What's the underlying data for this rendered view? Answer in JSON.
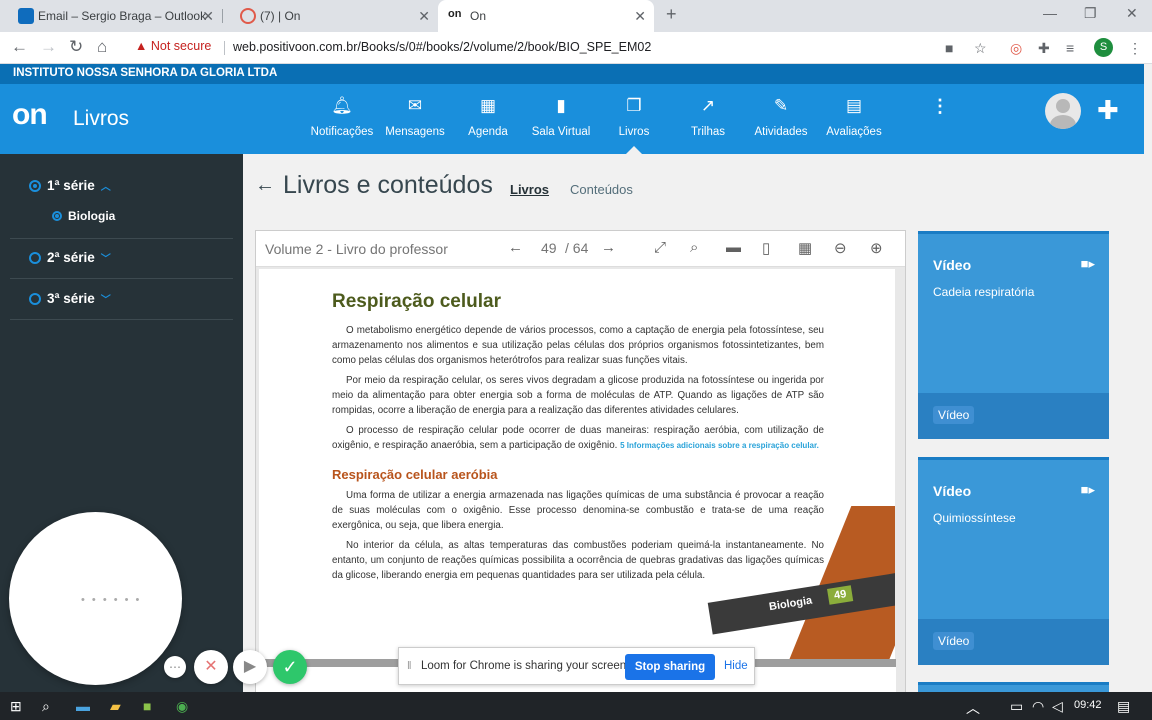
{
  "browser": {
    "tabs": [
      {
        "title": "Email – Sergio Braga – Outlook",
        "favicon": "outlook-icon"
      },
      {
        "title": "(7) | On",
        "favicon": "on-icon"
      },
      {
        "title": "On",
        "favicon": "on-icon"
      }
    ],
    "security": "Not secure",
    "url": "web.positivoon.com.br/Books/s/0#/books/2/volume/2/book/BIO_SPE_EM02",
    "profile_initial": "S"
  },
  "site": {
    "institution": "INSTITUTO NOSSA SENHORA DA GLORIA LTDA",
    "logo": "on",
    "brand": "Livros",
    "menu": [
      {
        "label": "Notificações",
        "icon": "bell-icon"
      },
      {
        "label": "Mensagens",
        "icon": "mail-icon"
      },
      {
        "label": "Agenda",
        "icon": "calendar-icon"
      },
      {
        "label": "Sala Virtual",
        "icon": "door-icon"
      },
      {
        "label": "Livros",
        "icon": "books-icon"
      },
      {
        "label": "Trilhas",
        "icon": "trend-icon"
      },
      {
        "label": "Atividades",
        "icon": "edit-icon"
      },
      {
        "label": "Avaliações",
        "icon": "clipboard-icon"
      }
    ]
  },
  "sidebar": {
    "series": [
      {
        "label": "1ª série",
        "selected": true
      },
      {
        "label": "2ª série",
        "selected": false
      },
      {
        "label": "3ª série",
        "selected": false
      }
    ],
    "subitem": "Biologia"
  },
  "main": {
    "title": "Livros e conteúdos",
    "tabs": [
      "Livros",
      "Conteúdos"
    ]
  },
  "viewer": {
    "volume": "Volume 2 - Livro do professor",
    "page": "49",
    "total": "/ 64",
    "doc": {
      "h1": "Respiração celular",
      "p1": "O metabolismo energético depende de vários processos, como a captação de energia pela fotossíntese, seu armazenamento nos alimentos e sua utilização pelas células dos próprios organismos fotossintetizantes, bem como pelas células dos organismos heterótrofos para realizar suas funções vitais.",
      "p2": "Por meio da respiração celular, os seres vivos degradam a glicose produzida na fotossíntese ou ingerida por meio da alimentação para obter energia sob a forma de moléculas de ATP. Quando as ligações de ATP são rompidas, ocorre a liberação de energia para a realização das diferentes atividades celulares.",
      "p3": "O processo de respiração celular pode ocorrer de duas maneiras: respiração aeróbia, com utilização de oxigênio, e respiração anaeróbia, sem a participação de oxigênio.",
      "p3_link": "5 Informações adicionais sobre a respiração celular.",
      "h2": "Respiração celular aeróbia",
      "p4": "Uma forma de utilizar a energia armazenada nas ligações químicas de uma substância é provocar a reação de suas moléculas com o oxigênio. Esse processo denomina-se combustão e trata-se de uma reação exergônica, ou seja, que libera energia.",
      "p5": "No interior da célula, as altas temperaturas das combustões poderiam queimá-la instantaneamente. No entanto, um conjunto de reações químicas possibilita a ocorrência de quebras gradativas das ligações químicas da glicose, liberando energia em pequenas quantidades para ser utilizada pela célula.",
      "ribbon_label": "Biologia",
      "ribbon_num": "49"
    }
  },
  "cards": [
    {
      "title": "Vídeo",
      "desc": "Cadeia respiratória",
      "tag": "Vídeo"
    },
    {
      "title": "Vídeo",
      "desc": "Quimiossíntese",
      "tag": "Vídeo"
    }
  ],
  "loom": {
    "message": "Loom for Chrome is sharing your screen.",
    "stop": "Stop sharing",
    "hide": "Hide"
  },
  "taskbar": {
    "time": "09:42"
  }
}
